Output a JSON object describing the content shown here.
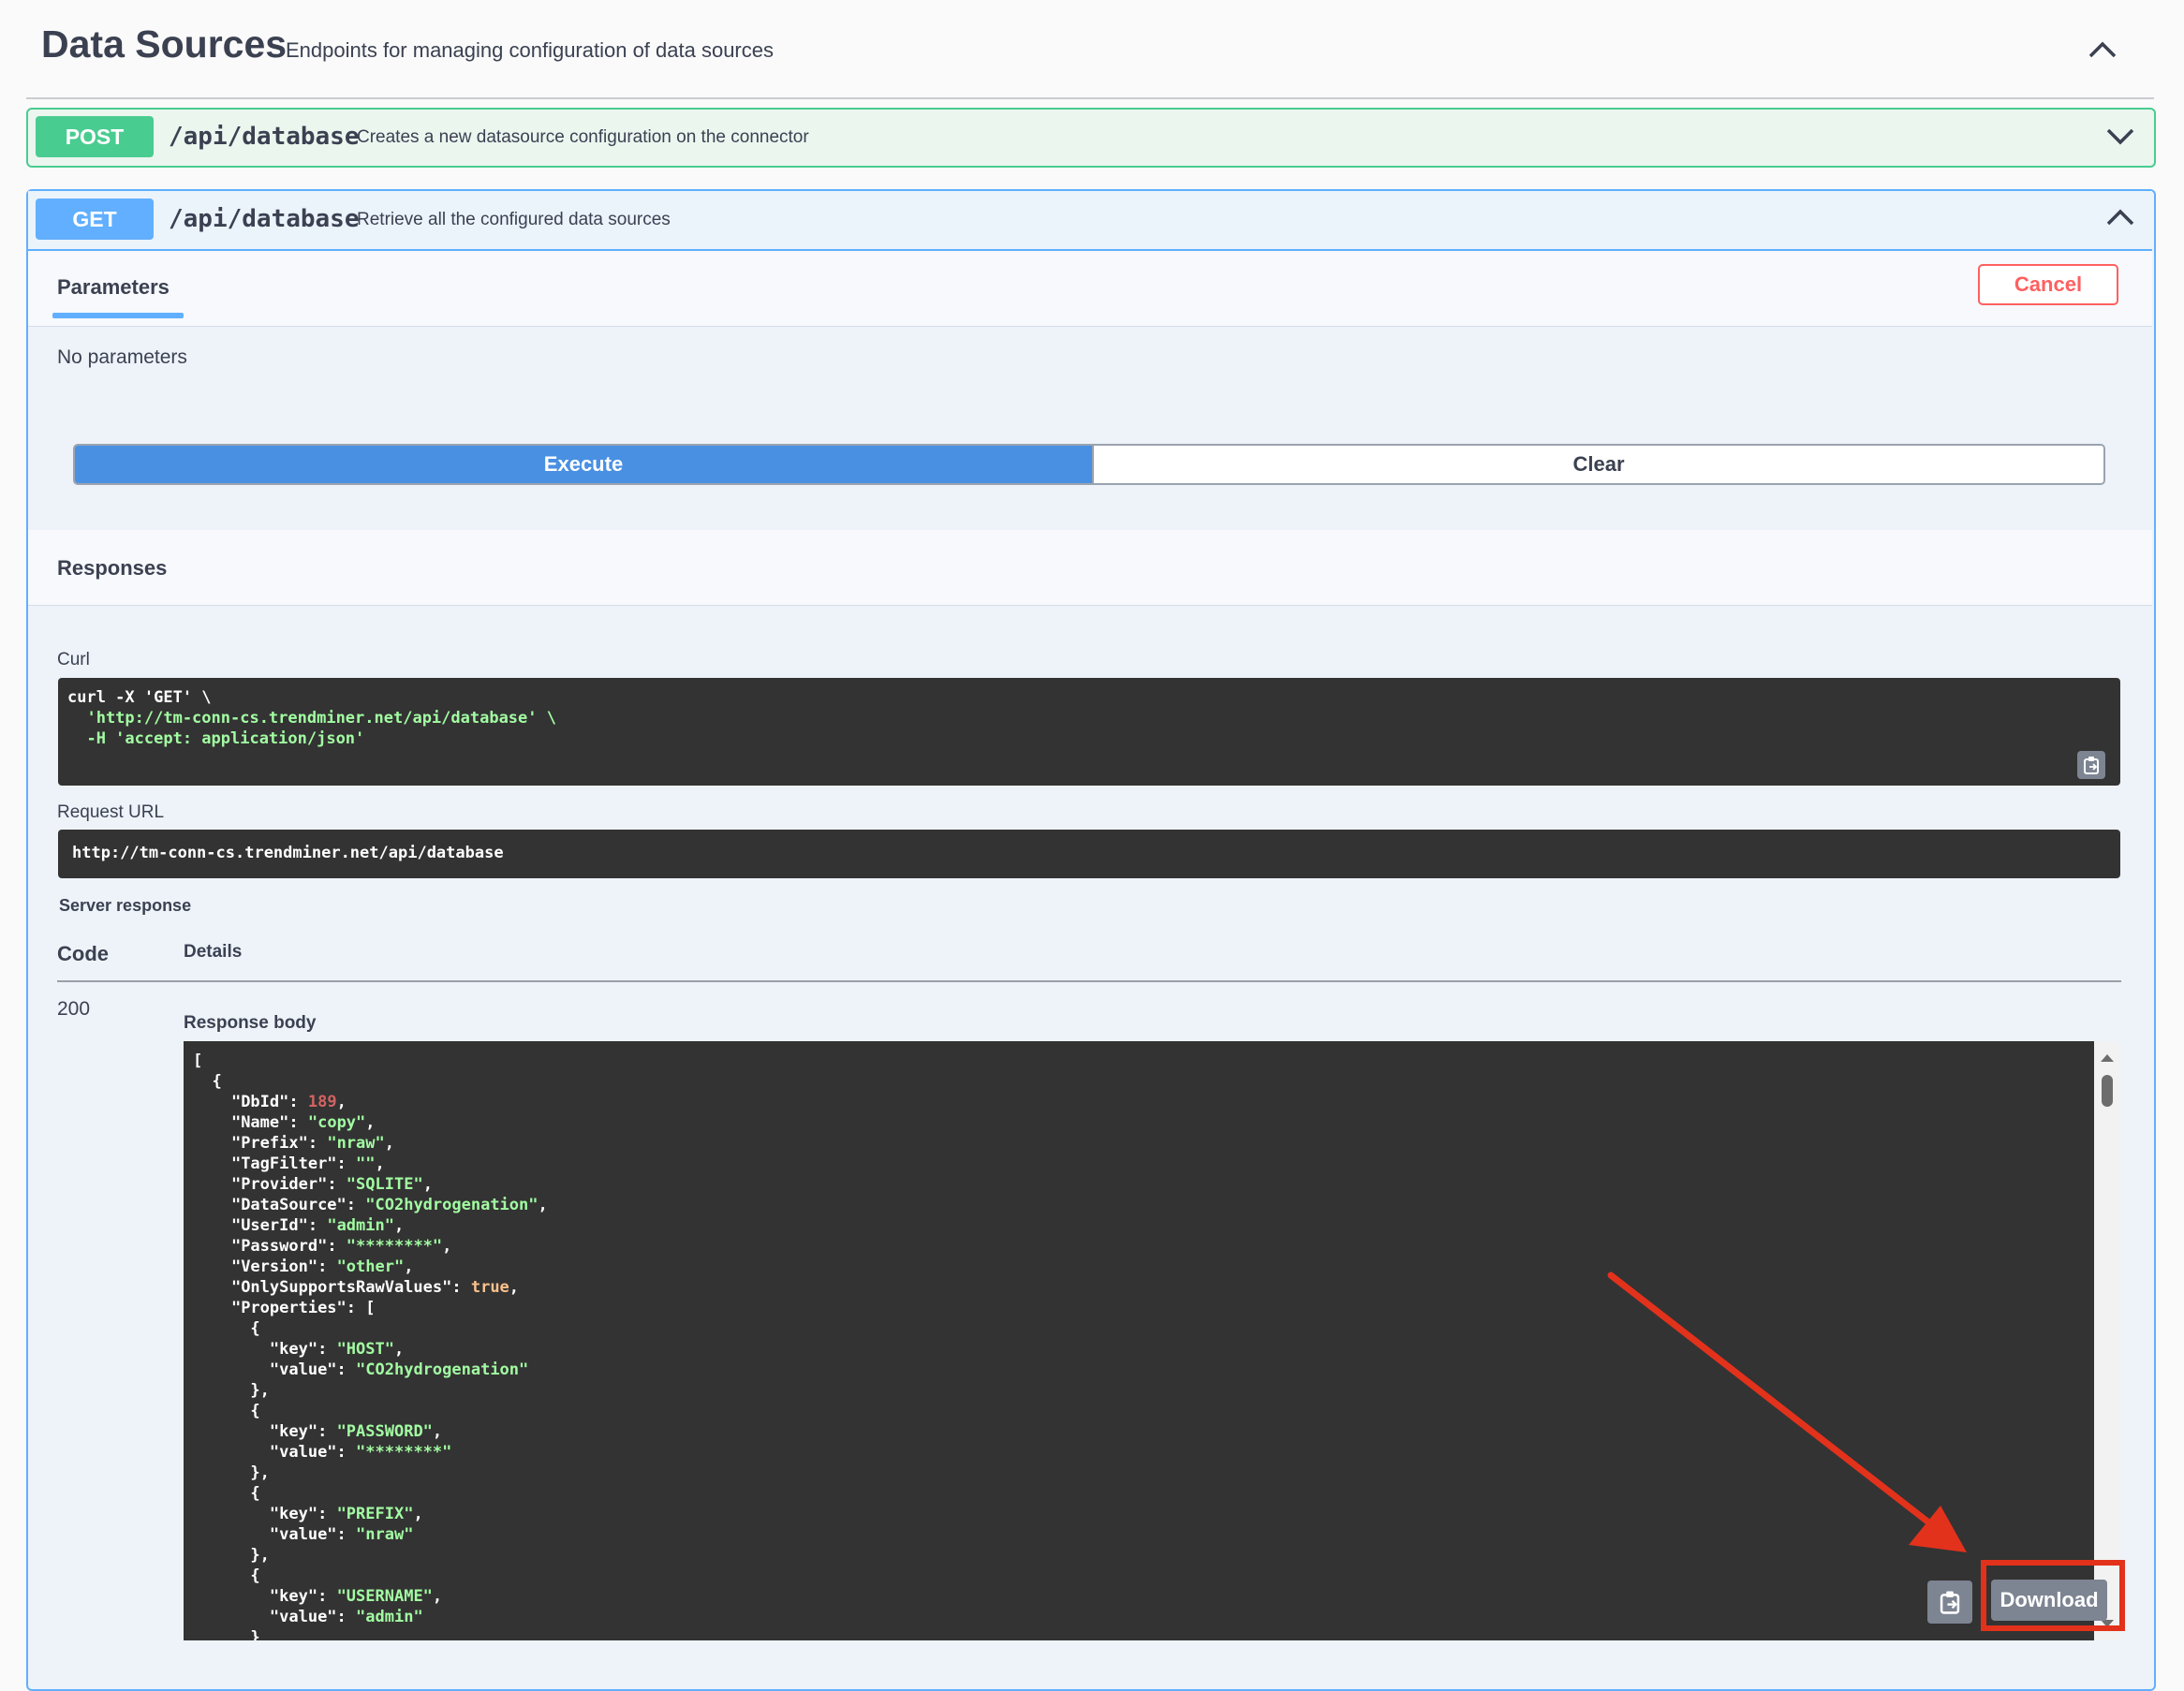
{
  "section": {
    "title": "Data Sources",
    "description": "Endpoints for managing configuration of data sources"
  },
  "operations": [
    {
      "method": "POST",
      "path": "/api/database",
      "summary": "Creates a new datasource configuration on the connector",
      "color": "#49cc90"
    },
    {
      "method": "GET",
      "path": "/api/database",
      "summary": "Retrieve all the configured data sources",
      "color": "#61affe"
    }
  ],
  "get_panel": {
    "tab_parameters": "Parameters",
    "cancel_label": "Cancel",
    "no_parameters": "No parameters",
    "execute_label": "Execute",
    "clear_label": "Clear",
    "responses_title": "Responses",
    "curl_label": "Curl",
    "curl_lines": [
      "curl -X 'GET' \\",
      "  'http://tm-conn-cs.trendminer.net/api/database' \\",
      "  -H 'accept: application/json'"
    ],
    "request_url_label": "Request URL",
    "request_url": "http://tm-conn-cs.trendminer.net/api/database",
    "server_response_label": "Server response",
    "code_header": "Code",
    "details_header": "Details",
    "status_code": "200",
    "response_body_label": "Response body",
    "download_label": "Download"
  }
}
